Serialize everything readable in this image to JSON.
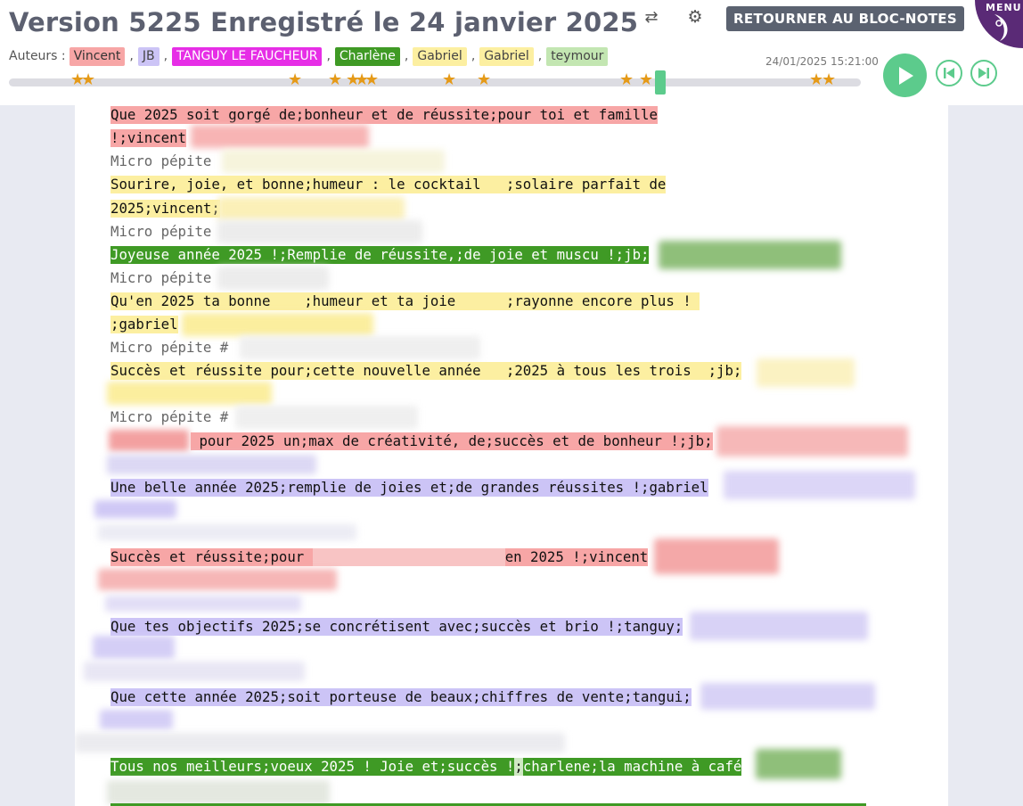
{
  "header": {
    "title": "Version 5225 Enregistré le 24 janvier 2025",
    "back_label": "RETOURNER AU BLOC-NOTES",
    "menu_label": "MENU",
    "timestamp": "24/01/2025 15:21:00"
  },
  "authors": {
    "label": "Auteurs :",
    "separator": ",",
    "list": [
      {
        "name": "Vincent",
        "color": "#f7a6a6"
      },
      {
        "name": "JB",
        "color": "#ccc4f6"
      },
      {
        "name": "TANGUY LE FAUCHEUR",
        "color": "#e62ee6"
      },
      {
        "name": "Charlène",
        "color": "#3f9a25"
      },
      {
        "name": "Gabriel",
        "color": "#fcefa1"
      },
      {
        "name": "Gabriel",
        "color": "#fcefa1"
      },
      {
        "name": "teymour",
        "color": "#c3e6b2"
      }
    ]
  },
  "icons": {
    "swap": "swap-arrows-icon",
    "settings": "gear-icon",
    "menu": "crescent-logo-icon",
    "play": "play-icon",
    "prev": "skip-previous-icon",
    "next": "skip-next-icon",
    "star": "star-icon"
  },
  "document": {
    "l1": "Que 2025 soit gorgé de;bonheur et de réussite;pour toi et famille",
    "l2": "!;vincent",
    "mp1": "Micro pépite",
    "l3": "Sourire, joie, et bonne;humeur : le cocktail   ;solaire parfait de",
    "l4": "2025;vincent;",
    "mp2": "Micro pépite",
    "l5": "Joyeuse année 2025 !;Remplie de réussite,;de joie et muscu !;jb;",
    "mp3": "Micro pépite",
    "l6": "Qu'en 2025 ta bonne    ;humeur et ta joie      ;rayonne encore plus ! ",
    "l7": ";gabriel",
    "mp4": "Micro pépite #",
    "l8": "Succès et réussite pour;cette nouvelle année   ;2025 à tous les trois  ;jb;",
    "mp5": "Micro pépite #",
    "l9": " pour 2025 un;max de créativité, de;succès et de bonheur !;jb;",
    "l10": "Une belle année 2025;remplie de joies et;de grandes réussites !;gabriel",
    "l11a": "Succès et réussite;pour ",
    "l11b": "en 2025 !;vincent",
    "l12": "Que tes objectifs 2025;se concrétisent avec;succès et brio !;tanguy;",
    "l13": "Que cette année 2025;soit porteuse de beaux;chiffres de vente;tangui;",
    "l14a": "Tous nos meilleurs;voeux 2025 ! Joie et;succès !",
    "l14b": ";",
    "l14c": "charlene;la machine à café"
  }
}
